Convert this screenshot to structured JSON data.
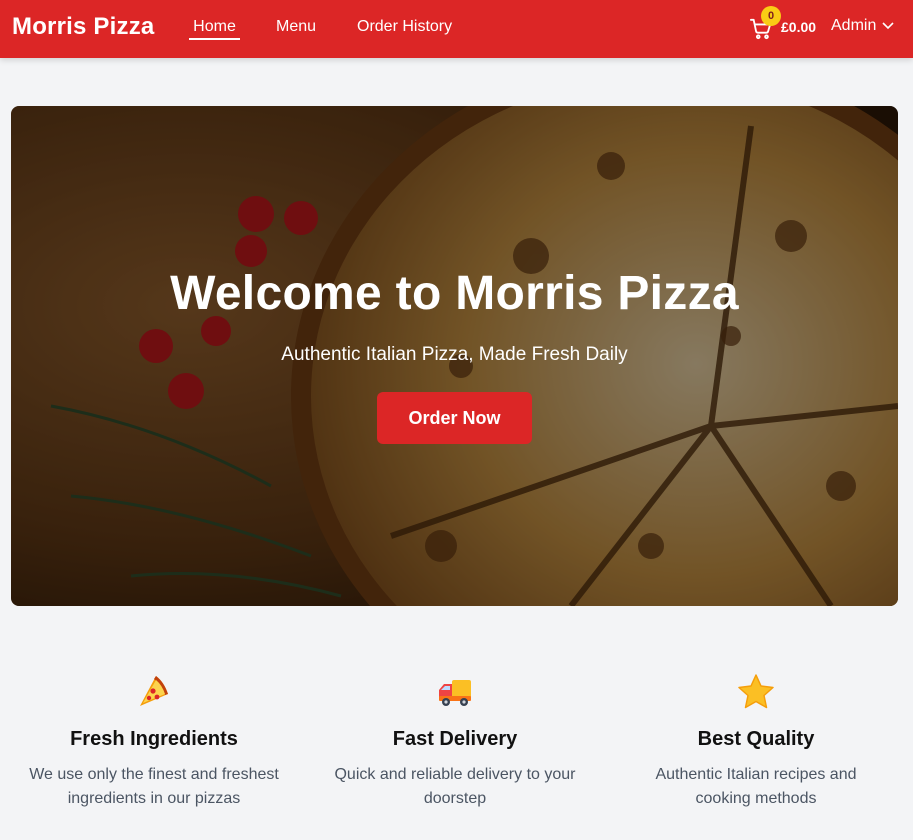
{
  "navbar": {
    "brand": "Morris Pizza",
    "links": [
      {
        "label": "Home",
        "active": true
      },
      {
        "label": "Menu",
        "active": false
      },
      {
        "label": "Order History",
        "active": false
      }
    ],
    "cart": {
      "count": "0",
      "total": "£0.00",
      "icon": "cart-icon"
    },
    "user": {
      "label": "Admin",
      "icon": "chevron-down-icon"
    },
    "color": "#dc2626"
  },
  "hero": {
    "title": "Welcome to Morris Pizza",
    "subtitle": "Authentic Italian Pizza, Made Fresh Daily",
    "cta_label": "Order Now",
    "image": "pizza-on-wooden-board"
  },
  "features": [
    {
      "icon": "pizza-slice-icon",
      "title": "Fresh Ingredients",
      "description": "We use only the finest and freshest ingredients in our pizzas"
    },
    {
      "icon": "delivery-truck-icon",
      "title": "Fast Delivery",
      "description": "Quick and reliable delivery to your doorstep"
    },
    {
      "icon": "star-icon",
      "title": "Best Quality",
      "description": "Authentic Italian recipes and cooking methods"
    }
  ]
}
